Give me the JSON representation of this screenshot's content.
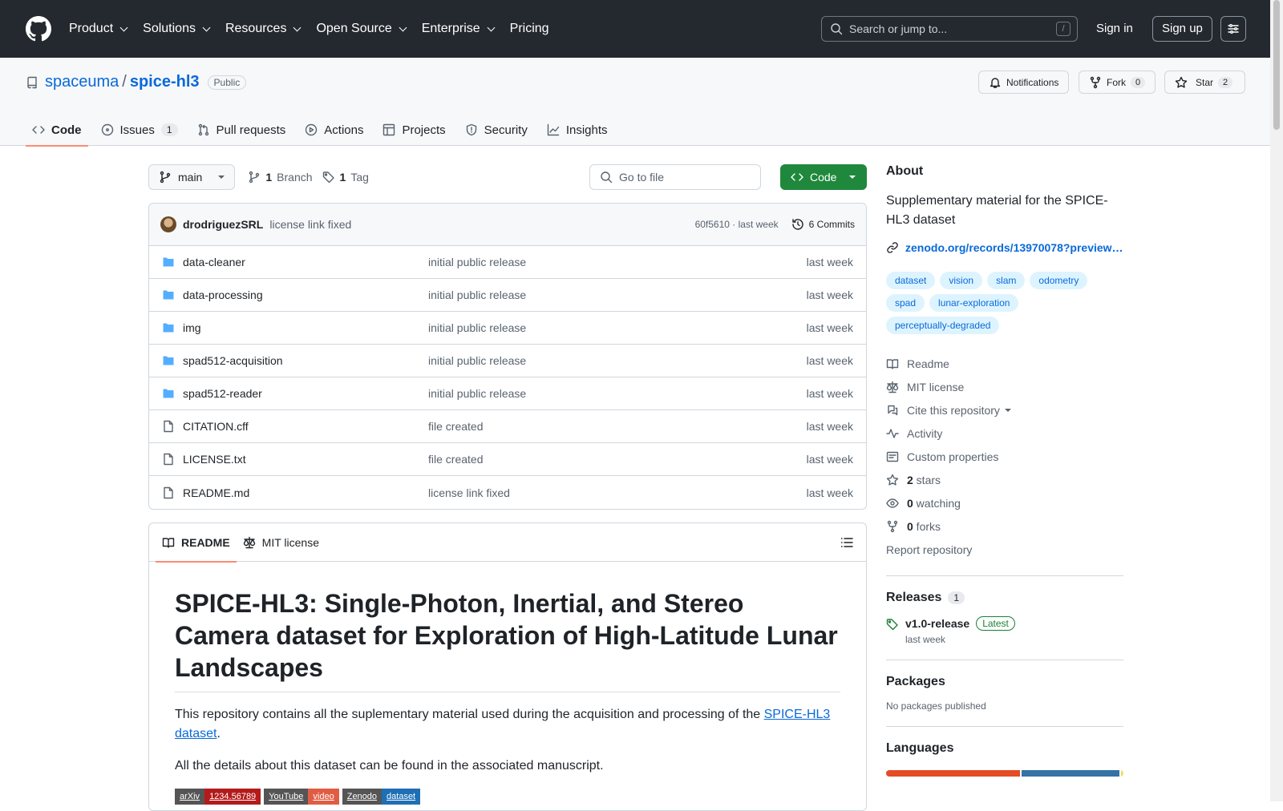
{
  "header": {
    "nav": [
      "Product",
      "Solutions",
      "Resources",
      "Open Source",
      "Enterprise",
      "Pricing"
    ],
    "search_placeholder": "Search or jump to...",
    "slash": "/",
    "signin": "Sign in",
    "signup": "Sign up"
  },
  "repo": {
    "owner": "spaceuma",
    "sep": "/",
    "name": "spice-hl3",
    "visibility": "Public",
    "notifications": "Notifications",
    "fork": "Fork",
    "fork_count": "0",
    "star": "Star",
    "star_count": "2"
  },
  "tabs": [
    {
      "label": "Code"
    },
    {
      "label": "Issues",
      "count": "1"
    },
    {
      "label": "Pull requests"
    },
    {
      "label": "Actions"
    },
    {
      "label": "Projects"
    },
    {
      "label": "Security"
    },
    {
      "label": "Insights"
    }
  ],
  "toolbar": {
    "branch": "main",
    "branch_count": "1",
    "branch_label": "Branch",
    "tag_count": "1",
    "tag_label": "Tag",
    "goto": "Go to file",
    "code": "Code"
  },
  "commit": {
    "author": "drodriguezSRL",
    "message": "license link fixed",
    "hash": "60f5610",
    "dot": " · ",
    "time": "last week",
    "commits": "6 Commits"
  },
  "files": [
    {
      "name": "data-cleaner",
      "type": "dir",
      "msg": "initial public release",
      "time": "last week"
    },
    {
      "name": "data-processing",
      "type": "dir",
      "msg": "initial public release",
      "time": "last week"
    },
    {
      "name": "img",
      "type": "dir",
      "msg": "initial public release",
      "time": "last week"
    },
    {
      "name": "spad512-acquisition",
      "type": "dir",
      "msg": "initial public release",
      "time": "last week"
    },
    {
      "name": "spad512-reader",
      "type": "dir",
      "msg": "initial public release",
      "time": "last week"
    },
    {
      "name": "CITATION.cff",
      "type": "file",
      "msg": "file created",
      "time": "last week"
    },
    {
      "name": "LICENSE.txt",
      "type": "file",
      "msg": "file created",
      "time": "last week"
    },
    {
      "name": "README.md",
      "type": "file",
      "msg": "license link fixed",
      "time": "last week"
    }
  ],
  "readme": {
    "tab_readme": "README",
    "tab_license": "MIT license",
    "title": "SPICE-HL3: Single-Photon, Inertial, and Stereo Camera dataset for Exploration of High-Latitude Lunar Landscapes",
    "p1_pre": "This repository contains all the suplementary material used during the acquisition and processing of the ",
    "p1_link": "SPICE-HL3 dataset",
    "p1_post": ".",
    "p2": "All the details about this dataset can be found in the associated manuscript.",
    "badges": [
      {
        "l": "arXiv",
        "r": "1234.56789",
        "color": "#b31b1b"
      },
      {
        "l": "YouTube",
        "r": "video",
        "color": "#e05d44"
      },
      {
        "l": "Zenodo",
        "r": "dataset",
        "color": "#1f6fb5"
      }
    ]
  },
  "about": {
    "title": "About",
    "desc": "Supplementary material for the SPICE-HL3 dataset",
    "link": "zenodo.org/records/13970078?preview…",
    "topics": [
      "dataset",
      "vision",
      "slam",
      "odometry",
      "spad",
      "lunar-exploration",
      "perceptually-degraded"
    ],
    "readme": "Readme",
    "license": "MIT license",
    "cite": "Cite this repository",
    "activity": "Activity",
    "custom": "Custom properties",
    "stars_n": "2",
    "stars": " stars",
    "watch_n": "0",
    "watch": " watching",
    "forks_n": "0",
    "forks": " forks",
    "report": "Report repository"
  },
  "releases": {
    "title": "Releases",
    "count": "1",
    "tag": "v1.0-release",
    "latest": "Latest",
    "time": "last week"
  },
  "packages": {
    "title": "Packages",
    "none": "No packages published"
  },
  "languages": {
    "title": "Languages",
    "segments": [
      {
        "color": "#e34c26",
        "pct": 56
      },
      {
        "color": "#3572a5",
        "pct": 41
      },
      {
        "color": "#f1e05a",
        "pct": 1
      }
    ]
  }
}
